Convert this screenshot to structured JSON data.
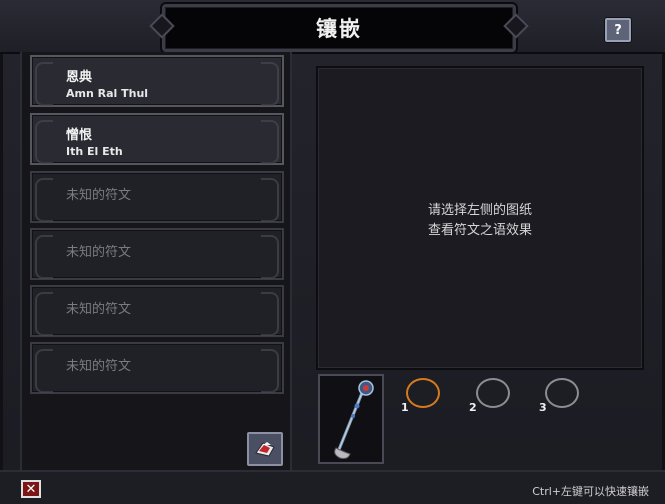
{
  "title": "镶嵌",
  "help_label": "?",
  "recipes": [
    {
      "name": "恩典",
      "runes": "Amn Ral Thul",
      "known": true
    },
    {
      "name": "憎恨",
      "runes": "Ith El Eth",
      "known": true
    },
    {
      "name": "未知的符文",
      "runes": "",
      "known": false
    },
    {
      "name": "未知的符文",
      "runes": "",
      "known": false
    },
    {
      "name": "未知的符文",
      "runes": "",
      "known": false
    },
    {
      "name": "未知的符文",
      "runes": "",
      "known": false
    }
  ],
  "info": {
    "line1": "请选择左侧的图纸",
    "line2": "查看符文之语效果"
  },
  "item": {
    "icon": "staff-icon"
  },
  "sockets": [
    {
      "label": "1",
      "active": true
    },
    {
      "label": "2",
      "active": false
    },
    {
      "label": "3",
      "active": false
    }
  ],
  "close_label": "✕",
  "hint": "Ctrl+左键可以快速镶嵌",
  "colors": {
    "active_socket": "#d77a1c",
    "close_button": "#7a1616",
    "button": "#4a4f63"
  }
}
